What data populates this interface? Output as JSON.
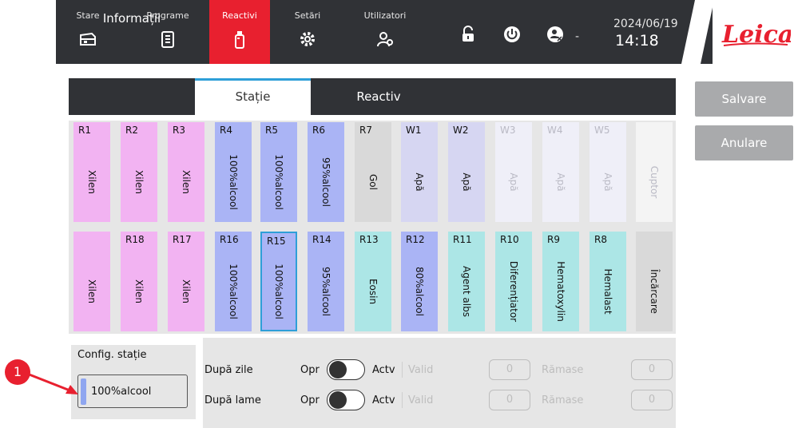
{
  "nav": {
    "items": [
      {
        "label": "Stare",
        "icon": "instrument-icon"
      },
      {
        "label": "Programe",
        "icon": "clipboard-icon"
      },
      {
        "label": "Reactivi",
        "icon": "bottle-icon"
      },
      {
        "label": "Setări",
        "icon": "gear-icon"
      },
      {
        "label": "Utilizatori",
        "icon": "users-icon"
      }
    ],
    "active_index": 2
  },
  "status": {
    "lock_icon": "unlock-icon",
    "power_icon": "power-icon",
    "user_icon": "user-icon",
    "user_value": "-"
  },
  "clock": {
    "date": "2024/06/19",
    "time": "14:18"
  },
  "logo": {
    "text": "Leica",
    "color": "#e8202f"
  },
  "tabs": [
    {
      "label": "Informații"
    },
    {
      "label": "Stație"
    },
    {
      "label": "Reactiv"
    }
  ],
  "active_tab": 1,
  "side_buttons": {
    "save": "Salvare",
    "cancel": "Anulare"
  },
  "colors": {
    "xilen": "#f2b3f2",
    "alcool": "#aab4f5",
    "gol": "#d9d9d9",
    "apa": "#d6d6f2",
    "apa_dim": "#efeff8",
    "cuptor": "#f4f4f4",
    "teal": "#ace6e6",
    "incarcare": "#d9d9d9",
    "accent": "#2e9fd8",
    "active_red": "#e8202f"
  },
  "stations_top": [
    {
      "code": "R1",
      "name": "Xilen",
      "color": "xilen"
    },
    {
      "code": "R2",
      "name": "Xilen",
      "color": "xilen"
    },
    {
      "code": "R3",
      "name": "Xilen",
      "color": "xilen"
    },
    {
      "code": "R4",
      "name": "100%alcool",
      "color": "alcool"
    },
    {
      "code": "R5",
      "name": "100%alcool",
      "color": "alcool"
    },
    {
      "code": "R6",
      "name": "95%alcool",
      "color": "alcool"
    },
    {
      "code": "R7",
      "name": "Gol",
      "color": "gol"
    },
    {
      "code": "W1",
      "name": "Apă",
      "color": "apa"
    },
    {
      "code": "W2",
      "name": "Apă",
      "color": "apa"
    },
    {
      "code": "W3",
      "name": "Apă",
      "color": "apa_dim",
      "dim": true
    },
    {
      "code": "W4",
      "name": "Apă",
      "color": "apa_dim",
      "dim": true
    },
    {
      "code": "W5",
      "name": "Apă",
      "color": "apa_dim",
      "dim": true
    },
    {
      "code": "",
      "name": "Cuptor",
      "color": "cuptor",
      "dim": true
    }
  ],
  "stations_bottom": [
    {
      "code": "",
      "name": "Xilen",
      "color": "xilen"
    },
    {
      "code": "R18",
      "name": "Xilen",
      "color": "xilen"
    },
    {
      "code": "R17",
      "name": "Xilen",
      "color": "xilen"
    },
    {
      "code": "R16",
      "name": "100%alcool",
      "color": "alcool"
    },
    {
      "code": "R15",
      "name": "100%alcool",
      "color": "alcool",
      "selected": true
    },
    {
      "code": "R14",
      "name": "95%alcool",
      "color": "alcool"
    },
    {
      "code": "R13",
      "name": "Eosin",
      "color": "teal"
    },
    {
      "code": "R12",
      "name": "80%alcool",
      "color": "alcool"
    },
    {
      "code": "R11",
      "name": "Agent albs",
      "color": "teal"
    },
    {
      "code": "R10",
      "name": "Diferențiator",
      "color": "teal"
    },
    {
      "code": "R9",
      "name": "Hematoxylin",
      "color": "teal"
    },
    {
      "code": "R8",
      "name": "Hemalast",
      "color": "teal"
    },
    {
      "code": "",
      "name": "Încărcare",
      "color": "incarcare"
    }
  ],
  "config": {
    "title": "Config. stație",
    "value": "100%alcool"
  },
  "options": {
    "rows": [
      {
        "label": "După zile",
        "off": "Opr",
        "on": "Actv",
        "valid": "Valid",
        "valid_value": "0",
        "remaining": "Rămase",
        "remaining_value": "0"
      },
      {
        "label": "După lame",
        "off": "Opr",
        "on": "Actv",
        "valid": "Valid",
        "valid_value": "0",
        "remaining": "Rămase",
        "remaining_value": "0"
      }
    ]
  },
  "callout": {
    "number": "1"
  }
}
